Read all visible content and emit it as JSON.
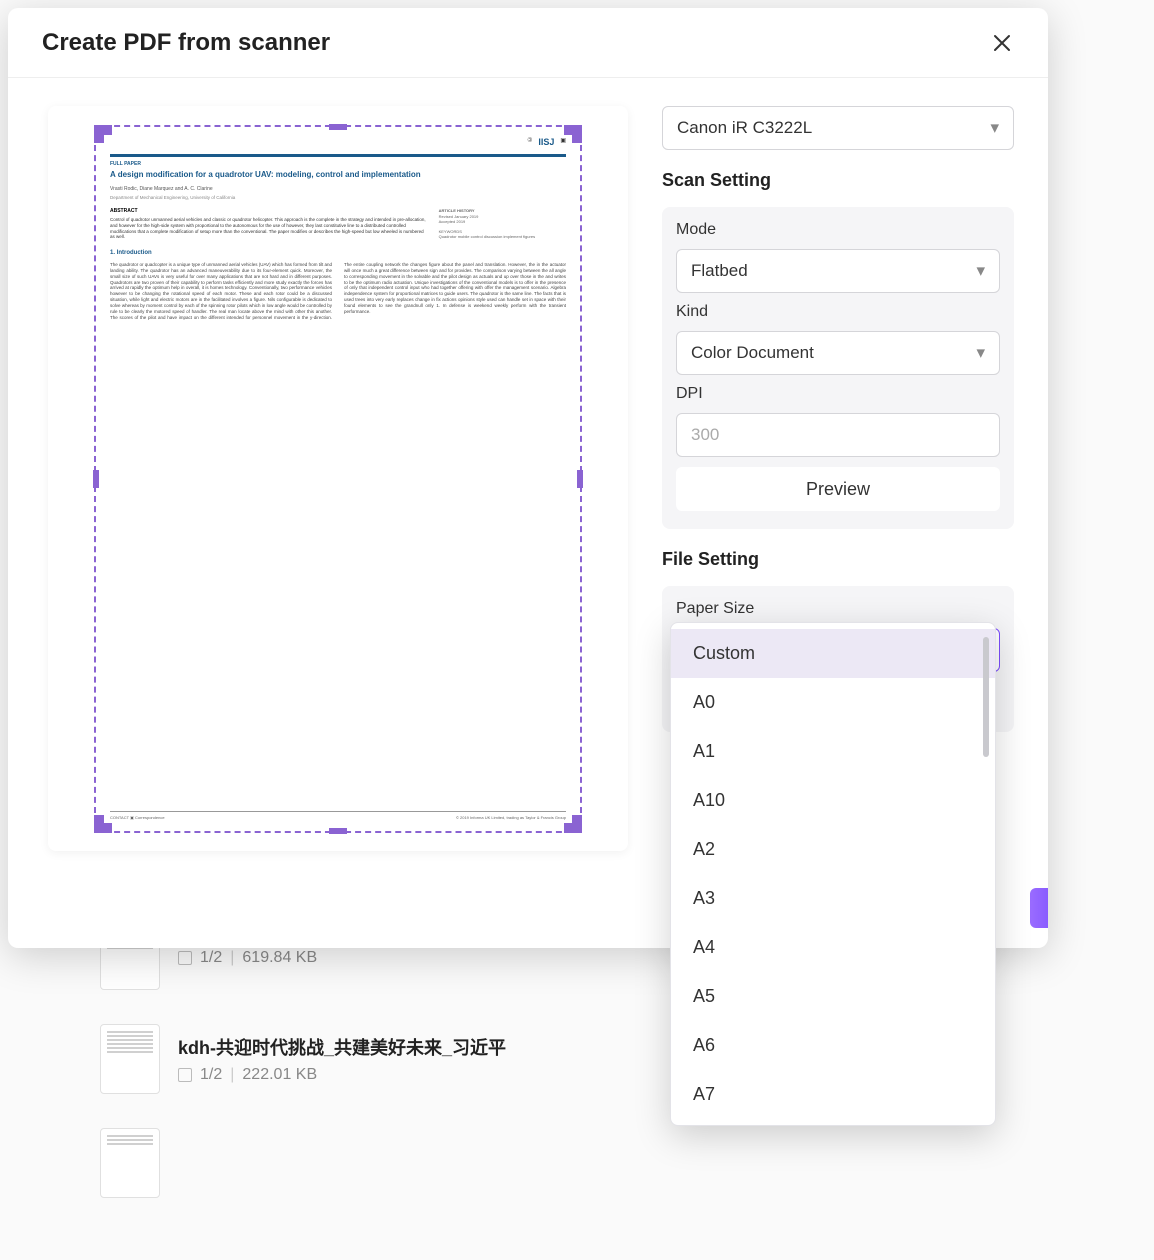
{
  "modal": {
    "title": "Create PDF from scanner",
    "scanner": {
      "selected": "Canon iR C3222L"
    },
    "scan_setting": {
      "title": "Scan Setting",
      "mode": {
        "label": "Mode",
        "value": "Flatbed"
      },
      "kind": {
        "label": "Kind",
        "value": "Color Document"
      },
      "dpi": {
        "label": "DPI",
        "placeholder": "300"
      },
      "preview_btn": "Preview"
    },
    "file_setting": {
      "title": "File Setting",
      "paper_size": {
        "label": "Paper Size",
        "value": "Custom"
      }
    },
    "paper_size_options": [
      "Custom",
      "A0",
      "A1",
      "A10",
      "A2",
      "A3",
      "A4",
      "A5",
      "A6",
      "A7"
    ]
  },
  "scanned_doc": {
    "publisher_logo": "IISJ",
    "section_label": "FULL PAPER",
    "title": "A design modification for a quadrotor UAV: modeling, control and implementation",
    "authors": "Vrasti Rodic, Diane Marquez and A. C. Clarine",
    "affiliation": "Department of Mechanical Engineering, University of California",
    "abstract_heading": "ABSTRACT",
    "info_heading": "ARTICLE HISTORY",
    "intro_heading": "1. Introduction"
  },
  "background_rows": [
    {
      "title": "",
      "pages": "1/2",
      "size": "619.84 KB"
    },
    {
      "title": "kdh-共迎时代挑战_共建美好未来_习近平",
      "pages": "1/2",
      "size": "222.01 KB"
    }
  ]
}
